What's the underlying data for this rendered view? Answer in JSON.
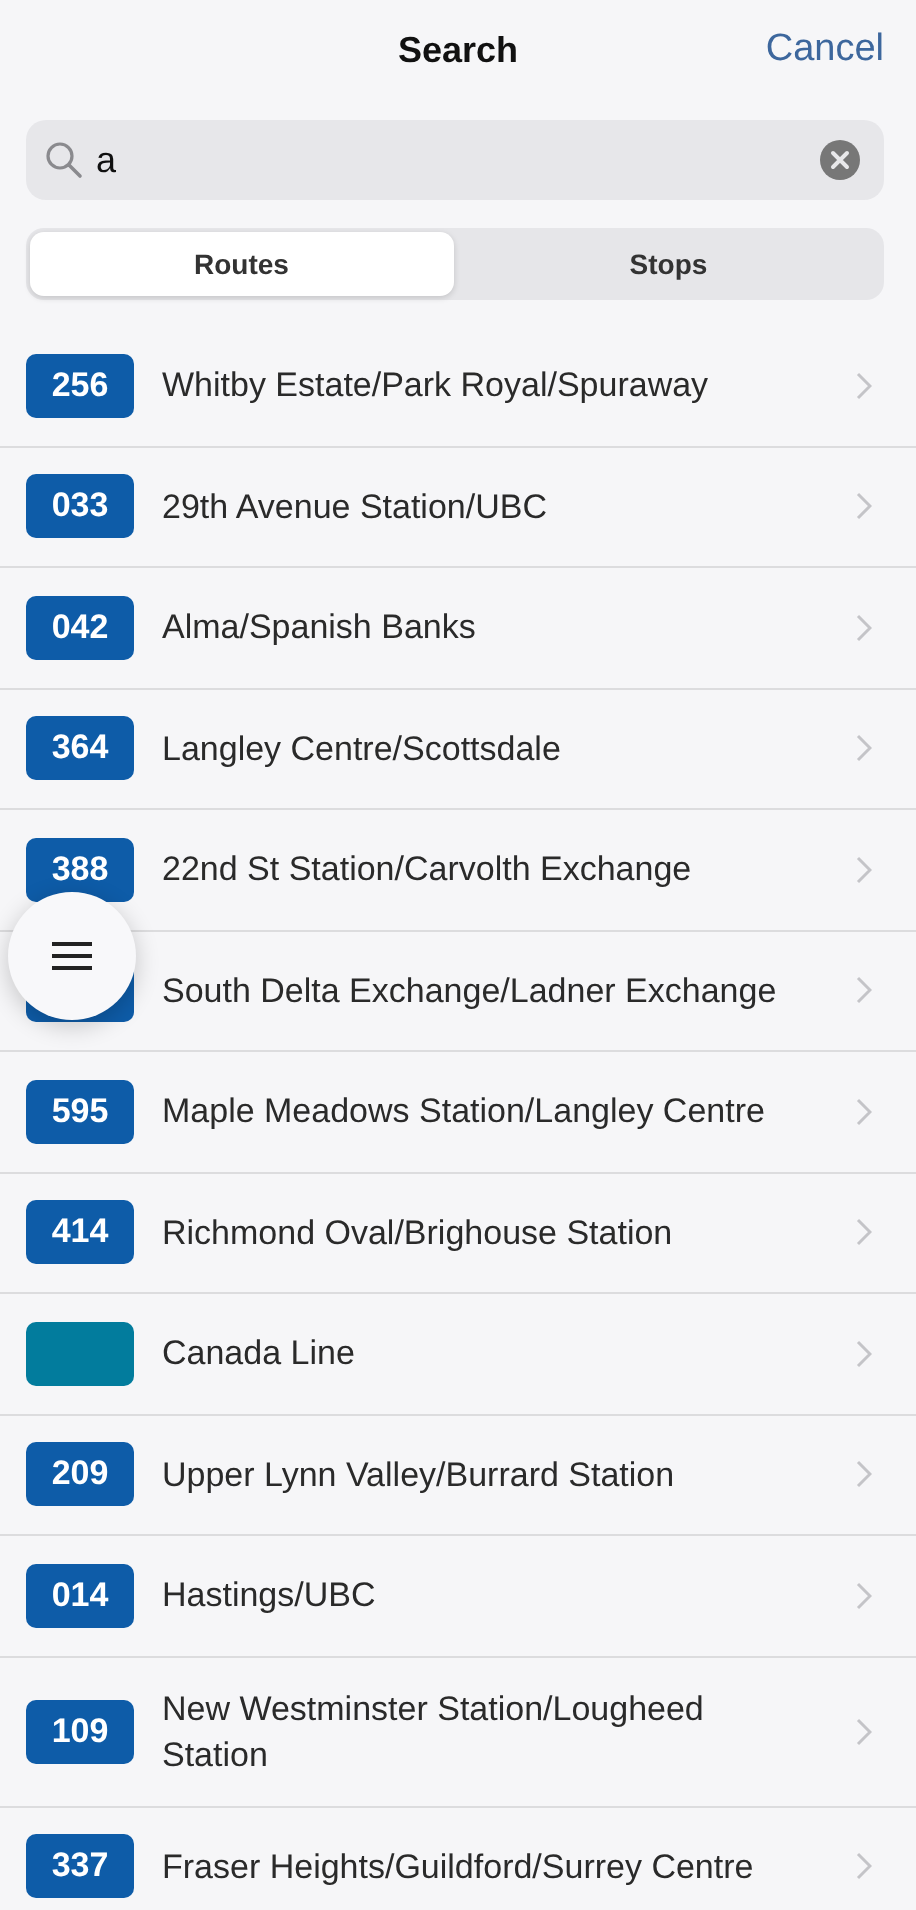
{
  "header": {
    "title": "Search",
    "cancel": "Cancel"
  },
  "search": {
    "value": "a"
  },
  "tabs": [
    {
      "label": "Routes",
      "selected": true
    },
    {
      "label": "Stops",
      "selected": false
    }
  ],
  "routes": [
    {
      "number": "256",
      "name": "Whitby Estate/Park Royal/Spuraway",
      "color": "#0e5ca8"
    },
    {
      "number": "033",
      "name": "29th Avenue Station/UBC",
      "color": "#0e5ca8"
    },
    {
      "number": "042",
      "name": "Alma/Spanish Banks",
      "color": "#0e5ca8"
    },
    {
      "number": "364",
      "name": "Langley Centre/Scottsdale",
      "color": "#0e5ca8"
    },
    {
      "number": "388",
      "name": "22nd St Station/Carvolth Exchange",
      "color": "#0e5ca8"
    },
    {
      "name": "South Delta Exchange/Ladner Exchange",
      "color": "#0e5ca8"
    },
    {
      "number": "595",
      "name": "Maple Meadows Station/Langley Centre",
      "color": "#0e5ca8"
    },
    {
      "number": "414",
      "name": "Richmond Oval/Brighouse Station",
      "color": "#0e5ca8"
    },
    {
      "name": "Canada Line",
      "color": "#027c9d"
    },
    {
      "number": "209",
      "name": "Upper Lynn Valley/Burrard Station",
      "color": "#0e5ca8"
    },
    {
      "number": "014",
      "name": "Hastings/UBC",
      "color": "#0e5ca8"
    },
    {
      "number": "109",
      "name": "New Westminster Station/Lougheed Station",
      "color": "#0e5ca8"
    },
    {
      "number": "337",
      "name": "Fraser Heights/Guildford/Surrey Centre",
      "color": "#0e5ca8"
    }
  ]
}
